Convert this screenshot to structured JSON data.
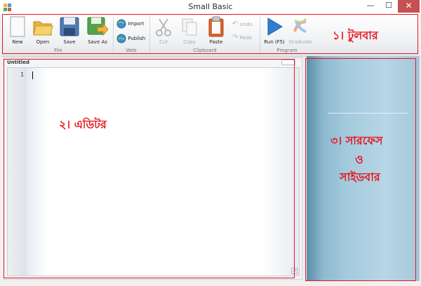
{
  "window": {
    "title": "Small Basic",
    "close_label": "✕",
    "minimize_label": "—",
    "maximize_label": "☐"
  },
  "ribbon": {
    "groups": {
      "file": "File",
      "web": "Web",
      "clipboard": "Clipboard",
      "program": "Program"
    },
    "buttons": {
      "new": "New",
      "open": "Open",
      "save": "Save",
      "save_as": "Save As",
      "import": "Import",
      "publish": "Publish",
      "cut": "Cut",
      "copy": "Copy",
      "paste": "Paste",
      "undo": "Undo",
      "redo": "Redo",
      "run": "Run (F5)",
      "graduate": "Graduate"
    }
  },
  "editor": {
    "document_title": "Untitled",
    "line_number": "1"
  },
  "annotations": {
    "toolbar": "১। টুলবার",
    "editor": "২। এডিটর",
    "surface_line1": "৩। সারফেস",
    "surface_line2": "ও",
    "surface_line3": "সাইডবার",
    "color": "#e8131b"
  }
}
